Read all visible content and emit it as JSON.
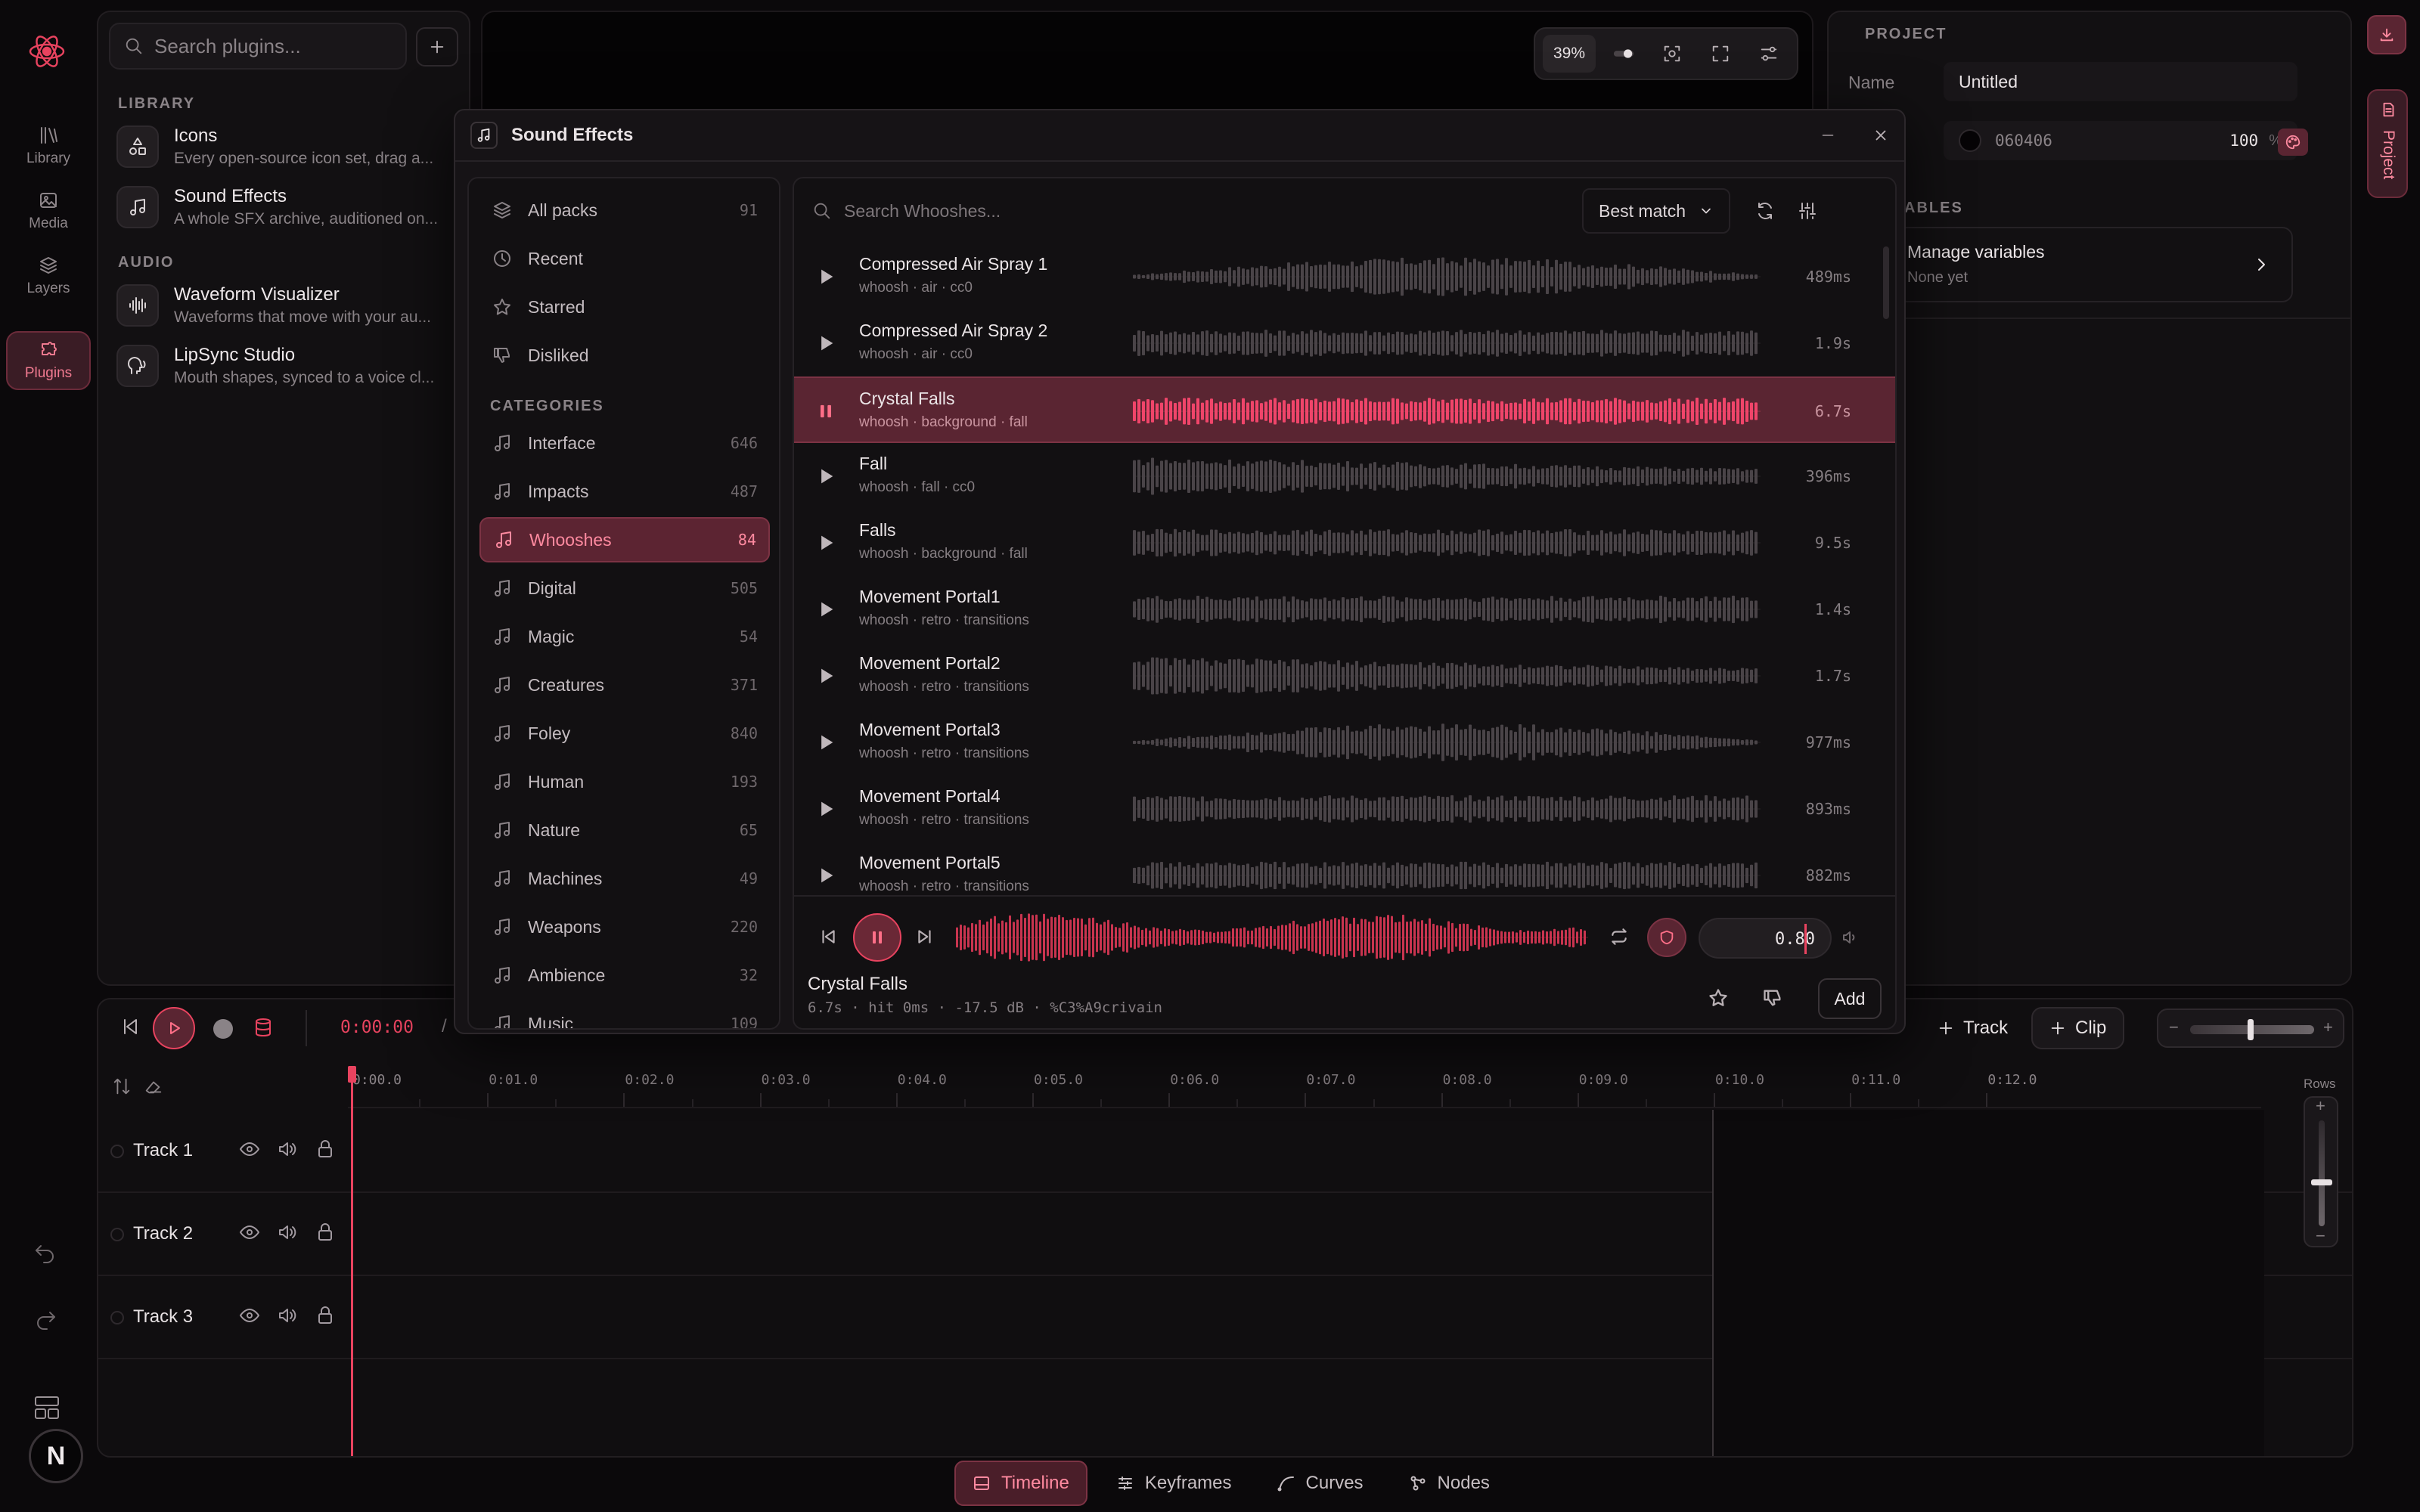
{
  "rail": {
    "items": [
      {
        "label": "Library",
        "icon": "library-icon"
      },
      {
        "label": "Media",
        "icon": "image-icon"
      },
      {
        "label": "Layers",
        "icon": "layers-icon"
      },
      {
        "label": "Plugins",
        "icon": "plugin-icon",
        "active": true
      }
    ],
    "avatar_letter": "N"
  },
  "plugins_panel": {
    "search_placeholder": "Search plugins...",
    "library_label": "LIBRARY",
    "audio_label": "AUDIO",
    "library_items": [
      {
        "title": "Icons",
        "desc": "Every open-source icon set, drag a..."
      },
      {
        "title": "Sound Effects",
        "desc": "A whole SFX archive, auditioned on..."
      }
    ],
    "audio_items": [
      {
        "title": "Waveform Visualizer",
        "desc": "Waveforms that move with your au..."
      },
      {
        "title": "LipSync Studio",
        "desc": "Mouth shapes, synced to a voice cl..."
      }
    ]
  },
  "canvas_toolbar": {
    "zoom": "39%"
  },
  "project_panel": {
    "section_label": "PROJECT",
    "name_label": "Name",
    "name_value": "Untitled",
    "color_hex": "060406",
    "opacity": "100",
    "opacity_unit": "%",
    "variables_label": "ABLES",
    "manage_variables": "Manage variables",
    "manage_variables_sub": "None yet",
    "side_tab": "Project"
  },
  "dialog": {
    "title": "Sound Effects",
    "search_placeholder": "Search Whooshes...",
    "sort_label": "Best match",
    "categories_label": "CATEGORIES",
    "top_items": [
      {
        "label": "All packs",
        "count": "91",
        "icon": "layers-icon"
      },
      {
        "label": "Recent",
        "count": "",
        "icon": "clock-icon"
      },
      {
        "label": "Starred",
        "count": "",
        "icon": "star-icon"
      },
      {
        "label": "Disliked",
        "count": "",
        "icon": "thumbs-down-icon"
      }
    ],
    "categories": [
      {
        "label": "Interface",
        "count": "646"
      },
      {
        "label": "Impacts",
        "count": "487"
      },
      {
        "label": "Whooshes",
        "count": "84",
        "active": true
      },
      {
        "label": "Digital",
        "count": "505"
      },
      {
        "label": "Magic",
        "count": "54"
      },
      {
        "label": "Creatures",
        "count": "371"
      },
      {
        "label": "Foley",
        "count": "840"
      },
      {
        "label": "Human",
        "count": "193"
      },
      {
        "label": "Nature",
        "count": "65"
      },
      {
        "label": "Machines",
        "count": "49"
      },
      {
        "label": "Weapons",
        "count": "220"
      },
      {
        "label": "Ambience",
        "count": "32"
      },
      {
        "label": "Music",
        "count": "109"
      }
    ],
    "results": [
      {
        "name": "Compressed Air Spray 1",
        "tags": "whoosh · air · cc0",
        "duration": "489ms"
      },
      {
        "name": "Compressed Air Spray 2",
        "tags": "whoosh · air · cc0",
        "duration": "1.9s"
      },
      {
        "name": "Crystal Falls",
        "tags": "whoosh · background · fall",
        "duration": "6.7s",
        "active": true
      },
      {
        "name": "Fall",
        "tags": "whoosh · fall · cc0",
        "duration": "396ms"
      },
      {
        "name": "Falls",
        "tags": "whoosh · background · fall",
        "duration": "9.5s"
      },
      {
        "name": "Movement Portal1",
        "tags": "whoosh · retro · transitions",
        "duration": "1.4s"
      },
      {
        "name": "Movement Portal2",
        "tags": "whoosh · retro · transitions",
        "duration": "1.7s"
      },
      {
        "name": "Movement Portal3",
        "tags": "whoosh · retro · transitions",
        "duration": "977ms"
      },
      {
        "name": "Movement Portal4",
        "tags": "whoosh · retro · transitions",
        "duration": "893ms"
      },
      {
        "name": "Movement Portal5",
        "tags": "whoosh · retro · transitions",
        "duration": "882ms"
      }
    ],
    "player": {
      "title": "Crystal Falls",
      "meta": "6.7s · hit 0ms · -17.5 dB · %C3%A9crivain",
      "volume": "0.80",
      "add_label": "Add"
    }
  },
  "transport": {
    "time": "0:00:00",
    "separator": "/"
  },
  "timeline_controls": {
    "track_label": "Track",
    "clip_label": "Clip",
    "rows_label": "Rows"
  },
  "ruler_ticks": [
    "0:00.0",
    "0:01.0",
    "0:02.0",
    "0:03.0",
    "0:04.0",
    "0:05.0",
    "0:06.0",
    "0:07.0",
    "0:08.0",
    "0:09.0",
    "0:10.0",
    "0:11.0",
    "0:12.0"
  ],
  "tracks": [
    {
      "name": "Track 1"
    },
    {
      "name": "Track 2"
    },
    {
      "name": "Track 3"
    }
  ],
  "bottom_tabs": [
    {
      "label": "Timeline",
      "active": true
    },
    {
      "label": "Keyframes"
    },
    {
      "label": "Curves"
    },
    {
      "label": "Nodes"
    }
  ],
  "colors": {
    "accent": "#e8435f",
    "accent_bg": "#5a2532",
    "bg": "#0b090b"
  }
}
